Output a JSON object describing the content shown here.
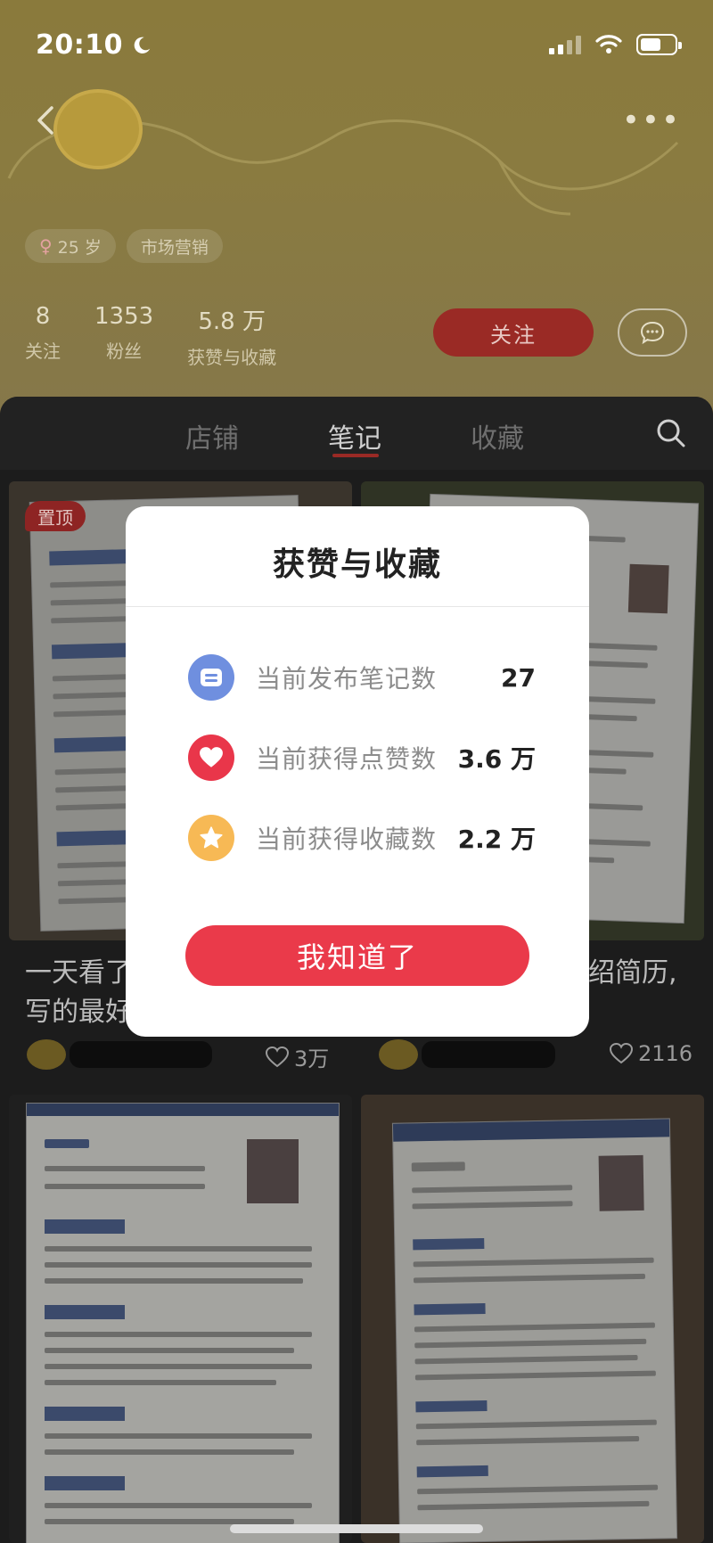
{
  "status_bar": {
    "time": "20:10"
  },
  "profile": {
    "tags": [
      {
        "icon": "female-icon",
        "label": "25 岁"
      },
      {
        "label": "市场营销"
      }
    ],
    "stats": [
      {
        "value": "8",
        "label": "关注"
      },
      {
        "value": "1353",
        "label": "粉丝"
      },
      {
        "value": "5.8 万",
        "label": "获赞与收藏"
      }
    ],
    "follow_label": "关注"
  },
  "tabs": [
    {
      "label": "店铺"
    },
    {
      "label": "笔记",
      "active": true
    },
    {
      "label": "收藏"
    }
  ],
  "feed": {
    "pin_label": "置顶",
    "cards": [
      {
        "title": "一天看了",
        "title2": "写的最好",
        "likes": "3万"
      },
      {
        "title": "绍简历,",
        "likes": "2116"
      }
    ]
  },
  "modal": {
    "title": "获赞与收藏",
    "rows": [
      {
        "icon": "note-icon",
        "color": "#6f8fdf",
        "label": "当前发布笔记数",
        "value": "27"
      },
      {
        "icon": "heart-icon",
        "color": "#e9364a",
        "label": "当前获得点赞数",
        "value": "3.6 万"
      },
      {
        "icon": "star-icon",
        "color": "#f7b955",
        "label": "当前获得收藏数",
        "value": "2.2 万"
      }
    ],
    "confirm_label": "我知道了"
  },
  "colors": {
    "accent": "#ea3a4a",
    "modal_bg": "#ffffff"
  }
}
